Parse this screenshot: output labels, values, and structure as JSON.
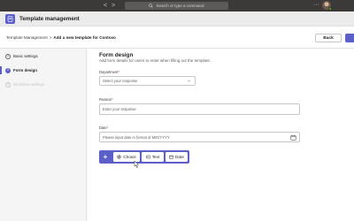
{
  "topbar": {
    "nav": [
      "<",
      ">"
    ],
    "search_placeholder": "Search or type a command",
    "more": "···",
    "icons": [
      "back-arrow-icon",
      "forward-arrow-icon",
      "search-icon",
      "more-icon",
      "avatar"
    ]
  },
  "app": {
    "title": "Template management",
    "icon": "template-app-icon",
    "accent": "#5b5fc7"
  },
  "breadcrumb": {
    "root": "Template Management",
    "separator": ">",
    "current": "Add a new template for Contoso"
  },
  "actions": {
    "back_label": "Back"
  },
  "steps": [
    {
      "number": "1",
      "label": "Basic settings",
      "state": "done"
    },
    {
      "number": "2",
      "label": "Form design",
      "state": "active"
    },
    {
      "number": "3",
      "label": "Workflow settings",
      "state": "disabled"
    }
  ],
  "form": {
    "title": "Form design",
    "subtitle": "Add form details for users to enter when filling out the template.",
    "fields": [
      {
        "label": "Department",
        "required": "*",
        "type": "dropdown",
        "placeholder": "Select your response"
      },
      {
        "label": "Reason",
        "required": "*",
        "type": "text",
        "placeholder": "Enter your response"
      },
      {
        "label": "Date",
        "required": "*",
        "type": "date",
        "placeholder": "Please input date in format of M/D/YYYY"
      }
    ]
  },
  "question_bar": {
    "add": "+",
    "options": [
      {
        "label": "Choice",
        "icon": "radio-choice-icon"
      },
      {
        "label": "Text",
        "icon": "text-field-icon"
      },
      {
        "label": "Date",
        "icon": "calendar-icon"
      }
    ]
  }
}
